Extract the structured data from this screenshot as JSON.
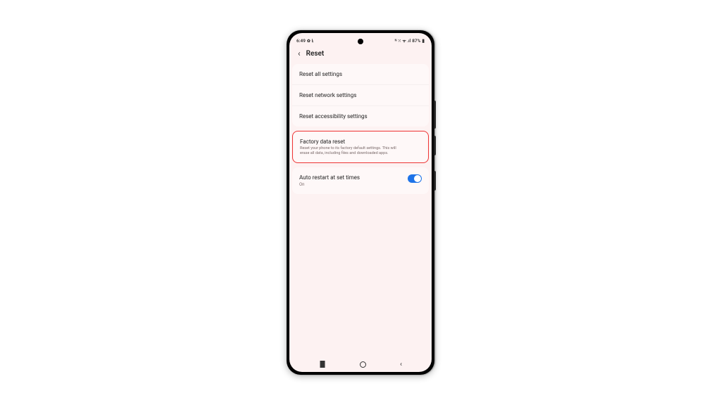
{
  "statusbar": {
    "time": "6:49",
    "left_icons": "✿ ⵑᵢ",
    "right_icons": "ᴺ ⁙ ᯤ .ıl",
    "battery_text": "87%",
    "battery_icon": "▮"
  },
  "header": {
    "title": "Reset"
  },
  "group1": {
    "item0": {
      "label": "Reset all settings"
    },
    "item1": {
      "label": "Reset network settings"
    },
    "item2": {
      "label": "Reset accessibility settings"
    }
  },
  "group2": {
    "item0": {
      "label": "Factory data reset",
      "sub": "Reset your phone to its factory default settings. This will erase all data, including files and downloaded apps."
    }
  },
  "group3": {
    "item0": {
      "label": "Auto restart at set times",
      "state": "On",
      "toggle_on": true
    }
  }
}
